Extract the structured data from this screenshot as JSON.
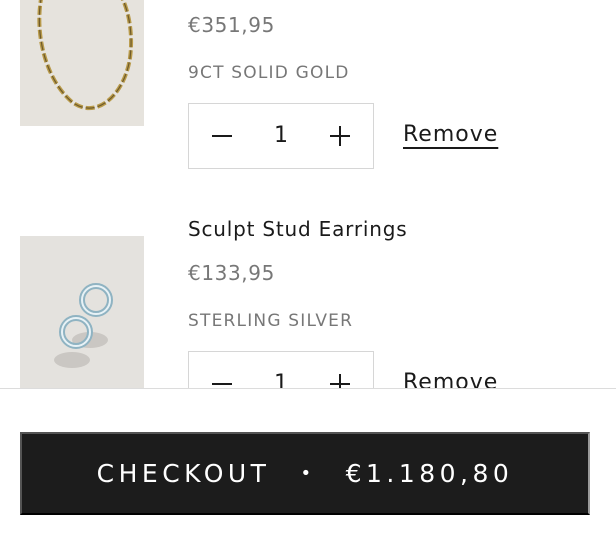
{
  "cart": {
    "items": [
      {
        "title": "",
        "price": "€351,95",
        "variant": "9CT SOLID GOLD",
        "quantity": "1",
        "remove_label": "Remove",
        "image_icon": "gold-chain-bracelet-photo"
      },
      {
        "title": "Sculpt Stud Earrings",
        "price": "€133,95",
        "variant": "STERLING SILVER",
        "quantity": "1",
        "remove_label": "Remove",
        "image_icon": "silver-hoop-earrings-photo"
      }
    ]
  },
  "checkout": {
    "label": "CHECKOUT",
    "separator": "•",
    "total": "€1.180,80"
  },
  "colors": {
    "button_background": "#1c1c1c",
    "button_text": "#ffffff",
    "muted_text": "#777777",
    "product_image_background": "#e7e5e1"
  }
}
